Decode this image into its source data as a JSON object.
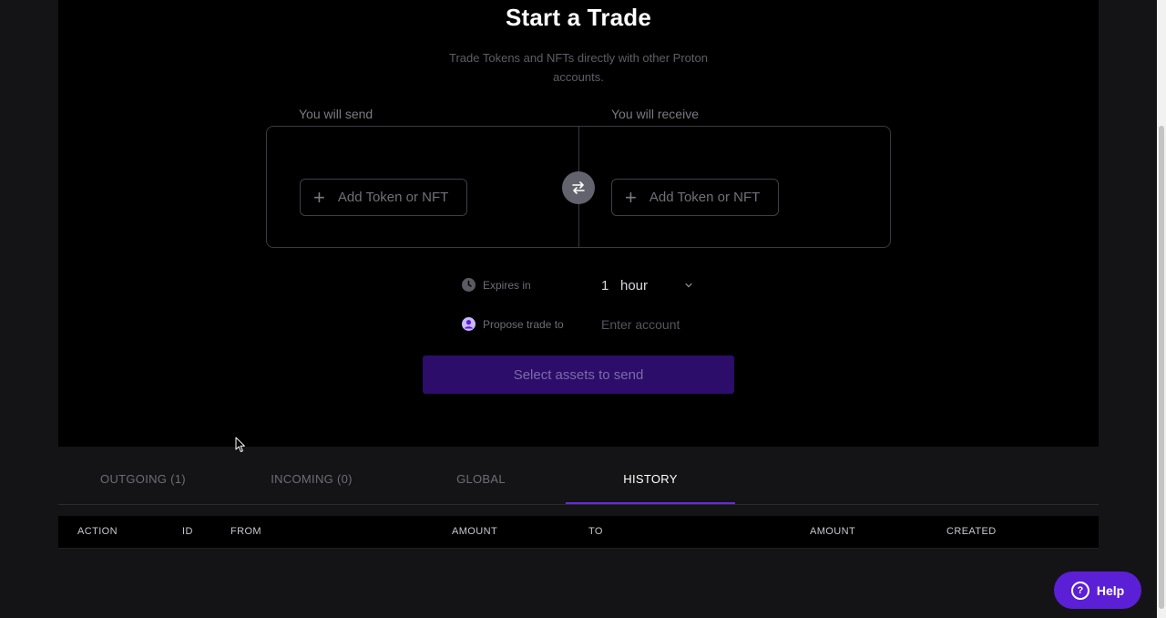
{
  "trade": {
    "title": "Start a Trade",
    "subtitle": "Trade Tokens and NFTs directly with other Proton accounts.",
    "send_label": "You will send",
    "receive_label": "You will receive",
    "add_send_label": "Add Token or NFT",
    "add_receive_label": "Add Token or NFT",
    "expires_label": "Expires in",
    "expires_amount": "1",
    "expires_unit": "hour",
    "propose_label": "Propose trade to",
    "account_placeholder": "Enter account",
    "submit_label": "Select assets to send"
  },
  "tabs": [
    {
      "label": "OUTGOING (1)",
      "active": false
    },
    {
      "label": "INCOMING (0)",
      "active": false
    },
    {
      "label": "GLOBAL",
      "active": false
    },
    {
      "label": "HISTORY",
      "active": true
    }
  ],
  "table": {
    "columns": [
      "ACTION",
      "ID",
      "FROM",
      "AMOUNT",
      "TO",
      "AMOUNT",
      "CREATED"
    ]
  },
  "help": {
    "label": "Help"
  },
  "icons": {
    "swap": "swap-arrows-icon",
    "clock": "clock-icon",
    "user": "user-avatar-icon",
    "chevron": "chevron-down-icon",
    "help": "question-circle-icon"
  },
  "colors": {
    "accent": "#6a2ae0",
    "help_bg": "#5b1fd6",
    "submit_bg": "#2c0d69"
  }
}
